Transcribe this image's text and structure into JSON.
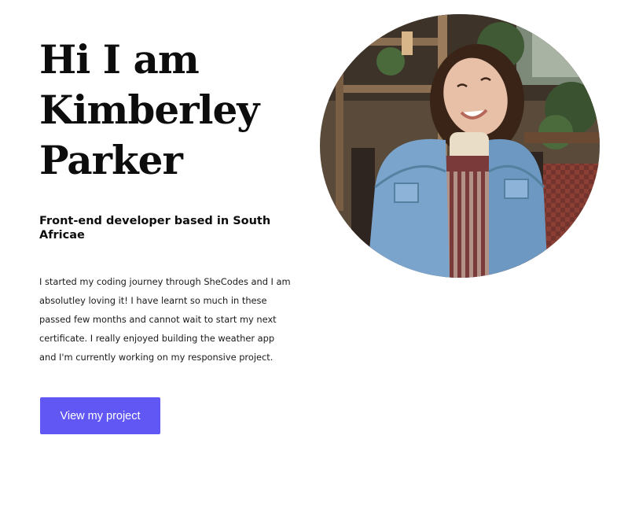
{
  "hero": {
    "title_lines": [
      "Hi I am",
      "Kimberley",
      "Parker"
    ],
    "subtitle": "Front-end developer based in South Africae",
    "bio": "I started my coding journey through SheCodes and I am absolutley loving it! I have learnt so much in these passed few months and cannot wait to start my next certificate. I really enjoyed building the weather app and I'm currently working on my responsive project.",
    "cta_label": "View my project"
  },
  "colors": {
    "accent": "#6157f5",
    "text": "#0d0d0d",
    "background": "#ffffff"
  }
}
